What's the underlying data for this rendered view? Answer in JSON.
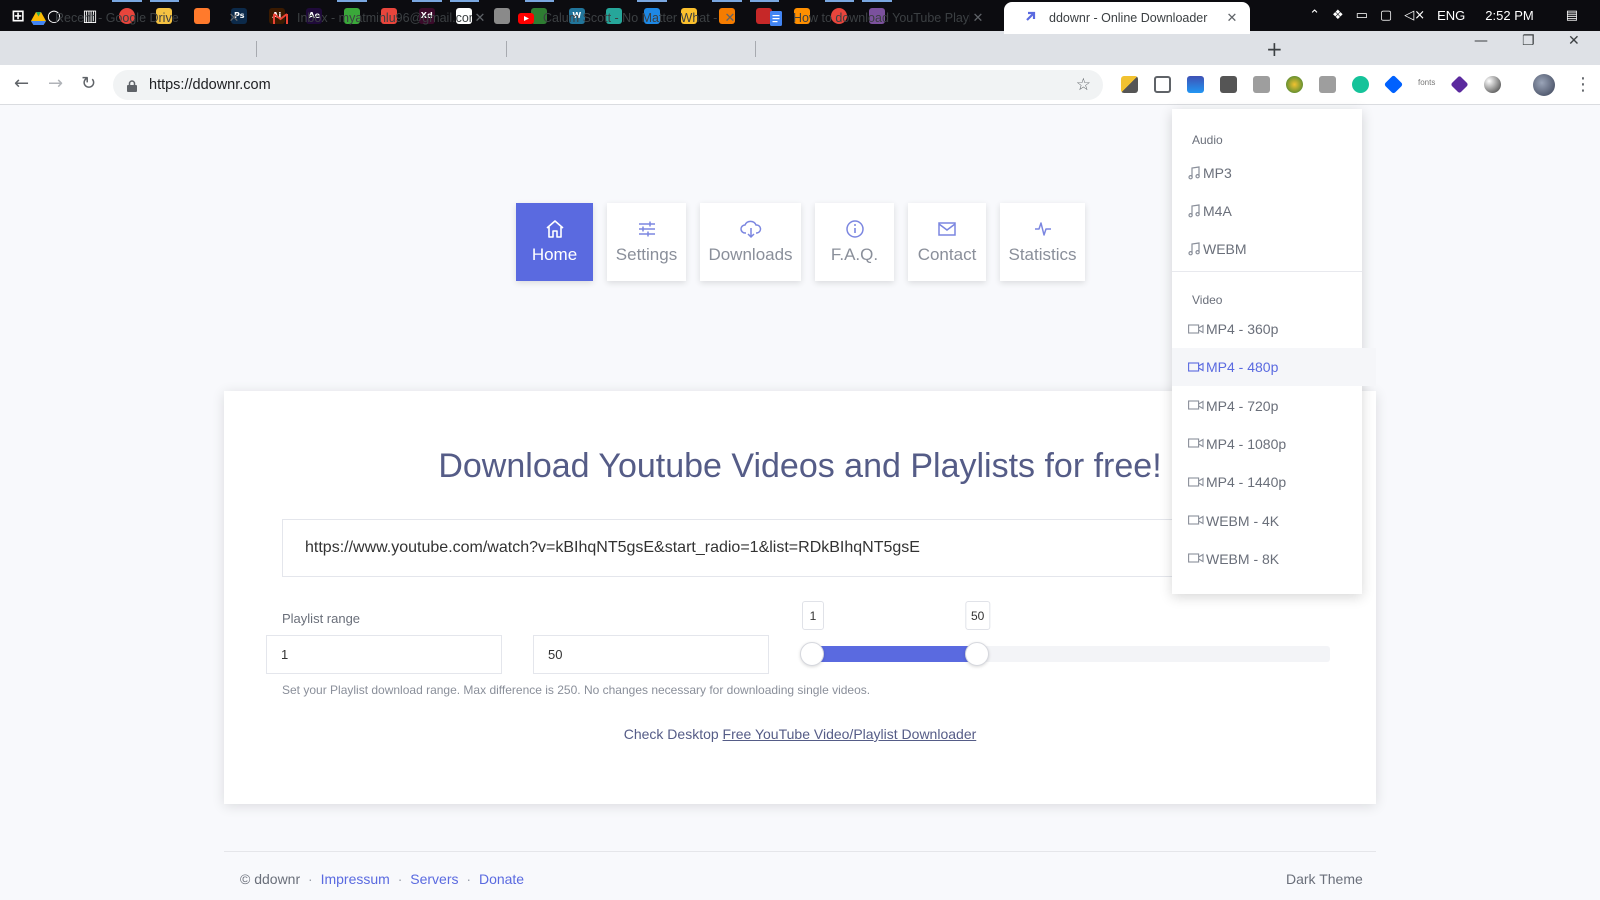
{
  "taskbar": {
    "apps": [
      {
        "icon": "windows-start-icon",
        "color": "#ffffff",
        "glyph": "⊞"
      },
      {
        "icon": "cortana-icon",
        "color": "#ffffff",
        "glyph": "○"
      },
      {
        "icon": "task-view-icon",
        "color": "#ffffff",
        "glyph": "▥"
      },
      {
        "icon": "chrome-icon",
        "color": "#e8453c",
        "glyph": ""
      },
      {
        "icon": "file-explorer-icon",
        "color": "#f5c242",
        "glyph": ""
      },
      {
        "icon": "firefox-icon",
        "color": "#ff7a2c",
        "glyph": ""
      },
      {
        "icon": "photoshop-icon",
        "color": "#0c2a4a",
        "glyph": "Ps"
      },
      {
        "icon": "illustrator-icon",
        "color": "#3a1a00",
        "glyph": "Ai"
      },
      {
        "icon": "after-effects-icon",
        "color": "#1f0a3a",
        "glyph": "Ae"
      },
      {
        "icon": "camtasia-icon",
        "color": "#3aa83a",
        "glyph": ""
      },
      {
        "icon": "snagit-icon",
        "color": "#e8453c",
        "glyph": ""
      },
      {
        "icon": "adobe-xd-icon",
        "color": "#3a0a2a",
        "glyph": "Xd"
      },
      {
        "icon": "zotero-icon",
        "color": "#ffffff",
        "glyph": ""
      },
      {
        "icon": "browser-icon",
        "color": "#8a8a8a",
        "glyph": ""
      },
      {
        "icon": "app-green-icon",
        "color": "#2e7d32",
        "glyph": ""
      },
      {
        "icon": "wordpress-icon",
        "color": "#21759b",
        "glyph": "W"
      },
      {
        "icon": "app-teal-icon",
        "color": "#26a69a",
        "glyph": ""
      },
      {
        "icon": "vscode-icon",
        "color": "#1e88e5",
        "glyph": ""
      },
      {
        "icon": "app-yellow-icon",
        "color": "#fbc02d",
        "glyph": ""
      },
      {
        "icon": "sublime-icon",
        "color": "#f57c00",
        "glyph": ""
      },
      {
        "icon": "filezilla-icon",
        "color": "#c62828",
        "glyph": ""
      },
      {
        "icon": "vlc-icon",
        "color": "#ff8f00",
        "glyph": ""
      },
      {
        "icon": "chrome-canary-icon",
        "color": "#e8453c",
        "glyph": ""
      },
      {
        "icon": "viber-icon",
        "color": "#7b519d",
        "glyph": ""
      }
    ],
    "language": "ENG",
    "time": "2:52 PM"
  },
  "tabs": [
    {
      "title": "Recent - Google Drive",
      "favicon": "google-drive-icon"
    },
    {
      "title": "Inbox - myatminlu96@gmail.com",
      "favicon": "gmail-icon"
    },
    {
      "title": "Calum Scott - No Matter What -",
      "favicon": "youtube-icon"
    },
    {
      "title": "How to download YouTube Playlis",
      "favicon": "google-docs-icon"
    },
    {
      "title": "ddownr - Online Downloader",
      "favicon": "ddownr-icon"
    }
  ],
  "toolbar": {
    "url": "https://ddownr.com",
    "extensions_text": "fonts"
  },
  "nav": [
    {
      "label": "Home",
      "icon": "home-icon",
      "active": true
    },
    {
      "label": "Settings",
      "icon": "sliders-icon",
      "active": false
    },
    {
      "label": "Downloads",
      "icon": "cloud-download-icon",
      "active": false
    },
    {
      "label": "F.A.Q.",
      "icon": "info-icon",
      "active": false
    },
    {
      "label": "Contact",
      "icon": "mail-icon",
      "active": false
    },
    {
      "label": "Statistics",
      "icon": "activity-icon",
      "active": false
    }
  ],
  "main": {
    "headline": "Download Youtube Videos and Playlists for free!",
    "url_value": "https://www.youtube.com/watch?v=kBIhqNT5gsE&start_radio=1&list=RDkBIhqNT5gsE",
    "playlist_label": "Playlist range",
    "range_start": "1",
    "range_end": "50",
    "slider": {
      "min": 1,
      "max": 250,
      "start": 1,
      "end": 50
    },
    "slider_start_label": "1",
    "slider_end_label": "50",
    "hint": "Set your Playlist download range. Max difference is 250. No changes necessary for downloading single videos.",
    "desktop_prefix": "Check Desktop",
    "desktop_link": "Free YouTube Video/Playlist Downloader"
  },
  "format_menu": {
    "audio_header": "Audio",
    "audio": [
      "MP3",
      "M4A",
      "WEBM"
    ],
    "video_header": "Video",
    "video": [
      "MP4 - 360p",
      "MP4 - 480p",
      "MP4 - 720p",
      "MP4 - 1080p",
      "MP4 - 1440p",
      "WEBM - 4K",
      "WEBM - 8K"
    ],
    "highlighted": "MP4 - 480p"
  },
  "footer": {
    "copyright": "© ddownr",
    "links": [
      "Impressum",
      "Servers",
      "Donate"
    ],
    "separator": "·",
    "dark_theme": "Dark Theme"
  },
  "colors": {
    "accent": "#5a6ae0",
    "headline": "#555c87"
  }
}
